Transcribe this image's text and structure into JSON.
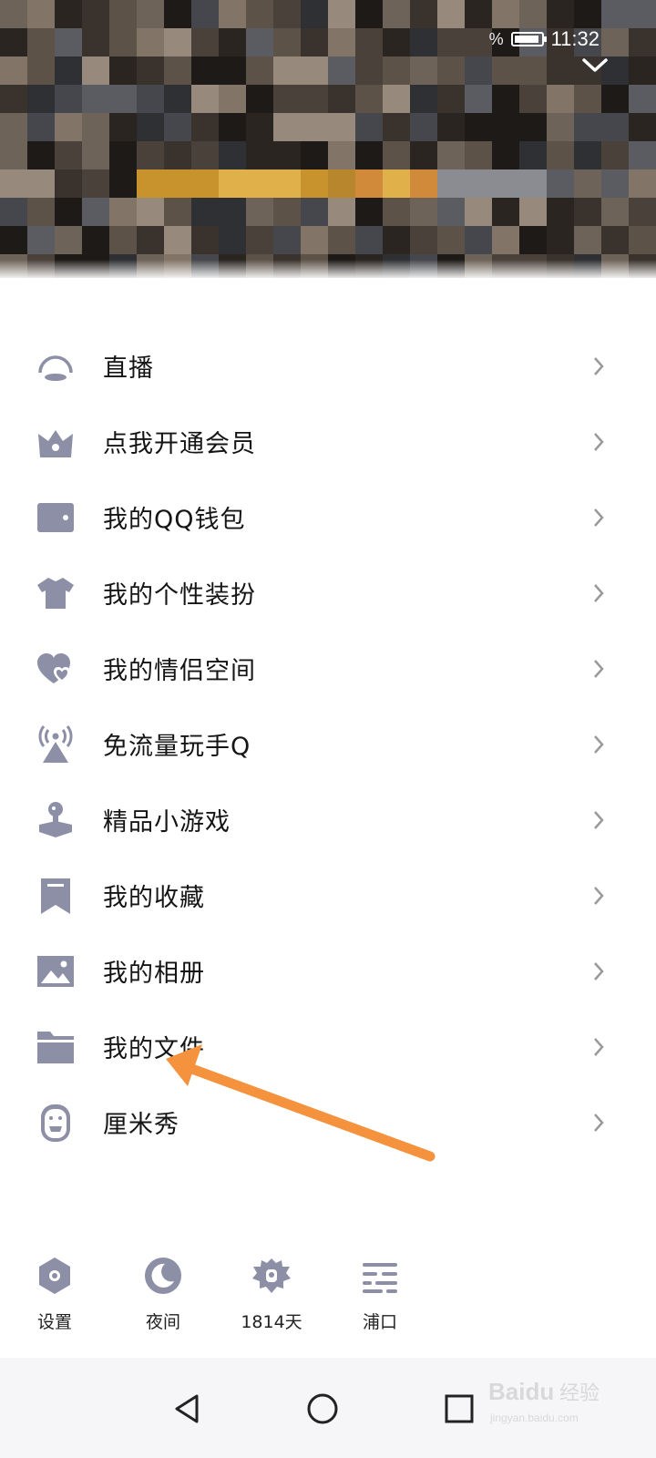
{
  "status_bar": {
    "battery_text": "%",
    "time": "11:32"
  },
  "menu": {
    "items": [
      {
        "label": "直播",
        "icon": "live-icon"
      },
      {
        "label": "点我开通会员",
        "icon": "vip-crown-icon"
      },
      {
        "label": "我的QQ钱包",
        "icon": "wallet-icon"
      },
      {
        "label": "我的个性装扮",
        "icon": "shirt-icon"
      },
      {
        "label": "我的情侣空间",
        "icon": "hearts-icon"
      },
      {
        "label": "免流量玩手Q",
        "icon": "signal-tower-icon"
      },
      {
        "label": "精品小游戏",
        "icon": "joystick-icon"
      },
      {
        "label": "我的收藏",
        "icon": "bookmark-icon"
      },
      {
        "label": "我的相册",
        "icon": "photo-icon"
      },
      {
        "label": "我的文件",
        "icon": "folder-icon"
      },
      {
        "label": "厘米秀",
        "icon": "avatar-face-icon"
      }
    ]
  },
  "bottom_bar": {
    "items": [
      {
        "label": "设置",
        "icon": "settings-icon"
      },
      {
        "label": "夜间",
        "icon": "night-moon-icon"
      },
      {
        "label": "1814天",
        "icon": "days-badge-icon"
      },
      {
        "label": "浦口",
        "icon": "weather-icon"
      }
    ]
  },
  "colors": {
    "icon_gray": "#8d8fa6",
    "arrow_orange": "#f5923e",
    "text": "#151515"
  },
  "watermark_text": "Baidu 经验 jingyan.baidu.com"
}
